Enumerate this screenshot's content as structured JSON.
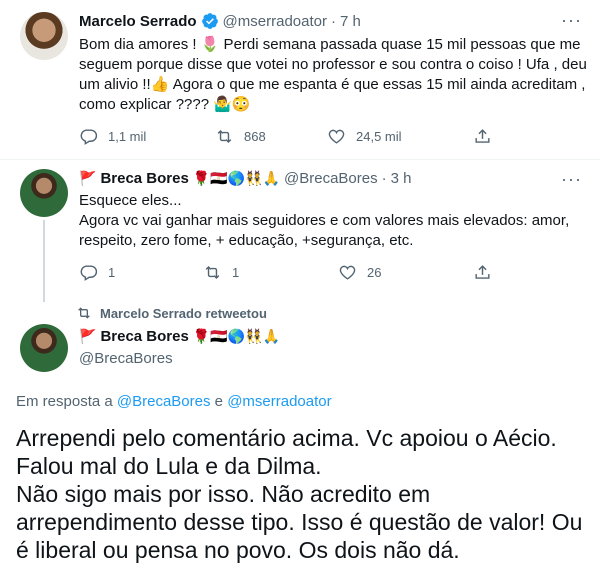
{
  "tweet1": {
    "name": "Marcelo Serrado",
    "handle": "@mserradoator",
    "dot": "·",
    "time": "7 h",
    "text_lines": [
      "Bom dia amores ! 🌷 Perdi semana passada quase 15 mil pessoas que me",
      "seguem porque disse que votei no professor e sou contra o coiso ! Ufa , deu",
      "um alivio !!👍 Agora o que me espanta é que essas 15 mil ainda acreditam ,",
      "como explicar ???? 🤷‍♂️😳"
    ],
    "replies": "1,1 mil",
    "retweets": "868",
    "likes": "24,5 mil"
  },
  "tweet2": {
    "flag_prefix": "🚩",
    "name": "Breca Bores",
    "name_emojis": "🌹🇪🇬🌎👯🙏",
    "handle": "@BrecaBores",
    "dot": "·",
    "time": "3 h",
    "text_lines": [
      "Esquece eles...",
      "Agora vc vai ganhar mais seguidores e com valores mais elevados: amor,",
      "respeito, zero fome, + educação, +segurança, etc."
    ],
    "replies": "1",
    "retweets": "1",
    "likes": "26"
  },
  "tweet3": {
    "retweet_label": "Marcelo Serrado retweetou",
    "flag_prefix": "🚩",
    "name": "Breca Bores",
    "name_emojis": "🌹🇪🇬🌎👯🙏",
    "handle": "@BrecaBores",
    "reply_prefix": "Em resposta a",
    "reply_user1": "@BrecaBores",
    "reply_and": "e",
    "reply_user2": "@mserradoator",
    "text_lines": [
      "Arrependi pelo comentário acima. Vc apoiou o Aécio.",
      "Falou mal do Lula e da Dilma.",
      "Não sigo mais por isso. Não acredito em",
      "arrependimento desse tipo. Isso é questão de valor! Ou",
      "é liberal ou pensa no povo. Os dois não dá."
    ]
  },
  "icons": {
    "more": "more-icon",
    "reply": "reply-icon",
    "retweet": "retweet-icon",
    "like": "like-icon",
    "share": "share-icon",
    "verified": "verified-badge-icon"
  },
  "colors": {
    "text": "#0f1419",
    "secondary": "#536471",
    "link": "#1d9bf0",
    "verified": "#1d9bf0"
  }
}
